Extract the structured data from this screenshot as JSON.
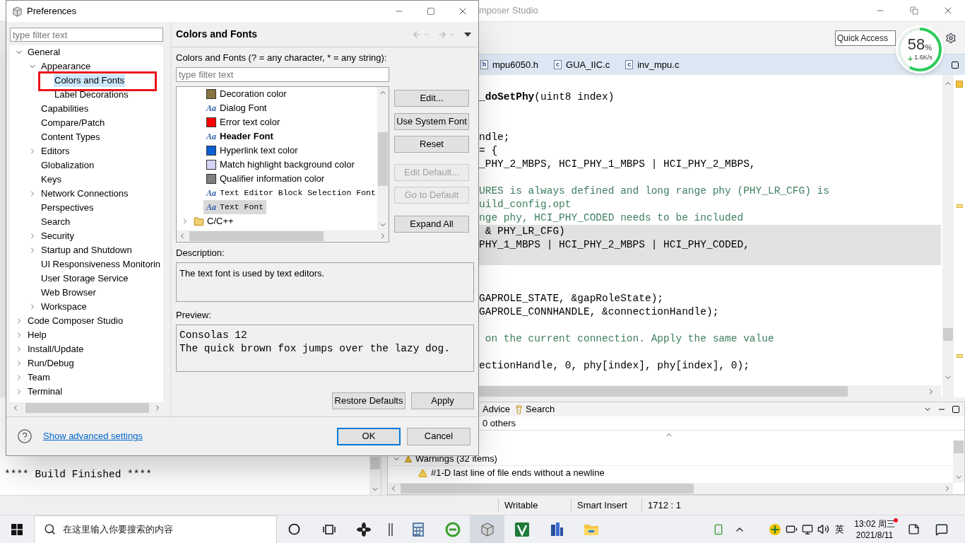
{
  "ide": {
    "title": "mposer Studio",
    "quick_access": "Quick Access",
    "net_meter": {
      "percent": "58",
      "unit": "%",
      "speed": "1.6K/s",
      "level": 0.58
    },
    "editor_tabs": [
      {
        "badge": "h",
        "label": "mpu6050.h",
        "selected": false
      },
      {
        "badge": "c",
        "label": "GUA_IIC.c",
        "selected": false
      },
      {
        "badge": "c",
        "label": "inv_mpu.c",
        "selected": false
      }
    ],
    "code_lines": [
      {
        "kind": "code",
        "text": "**_doSetPhy**(uint8 index)",
        "highlighted": false
      },
      {
        "kind": "blank",
        "highlighted": false
      },
      {
        "kind": "blank",
        "highlighted": false
      },
      {
        "kind": "code",
        "text": "ndle;",
        "highlighted": false
      },
      {
        "kind": "code",
        "text": "= {",
        "highlighted": false
      },
      {
        "kind": "code",
        "text": "_PHY_2_MBPS, HCI_PHY_1_MBPS | HCI_PHY_2_MBPS,",
        "highlighted": false
      },
      {
        "kind": "blank",
        "highlighted": false
      },
      {
        "kind": "comment",
        "text": "URES is always defined and long range phy (PHY_LR_CFG) is",
        "highlighted": false
      },
      {
        "kind": "comment",
        "text": "uild_config.opt",
        "highlighted": false
      },
      {
        "kind": "comment",
        "text": "nge phy, HCI_PHY_CODED needs to be included",
        "highlighted": false
      },
      {
        "kind": "code",
        "text": " & PHY_LR_CFG)",
        "highlighted": true
      },
      {
        "kind": "code",
        "text": "PHY_1_MBPS | HCI_PHY_2_MBPS | HCI_PHY_CODED,",
        "highlighted": true
      },
      {
        "kind": "blank",
        "highlighted": true
      },
      {
        "kind": "blank",
        "highlighted": false
      },
      {
        "kind": "blank",
        "highlighted": false
      },
      {
        "kind": "code",
        "text": "GAPROLE_STATE, &gapRoleState);",
        "highlighted": false
      },
      {
        "kind": "code",
        "text": "GAPROLE_CONNHANDLE, &connectionHandle);",
        "highlighted": false
      },
      {
        "kind": "blank",
        "highlighted": false
      },
      {
        "kind": "comment",
        "text": " on the current connection. Apply the same value",
        "highlighted": false
      },
      {
        "kind": "blank",
        "highlighted": false
      },
      {
        "kind": "code",
        "text": "ectionHandle, 0, phy[index], phy[index], 0);",
        "highlighted": false
      },
      {
        "kind": "blank",
        "highlighted": false
      }
    ],
    "problems": {
      "tabs": [
        {
          "label": "Advice",
          "selected": false
        },
        {
          "label": "Search",
          "selected": false
        }
      ],
      "summary": "0 others",
      "groups": [
        {
          "label": "Warnings (32 items)",
          "expanded": true,
          "items": [
            "#1-D last line of file ends without a newline"
          ]
        }
      ]
    },
    "console": {
      "lines": [
        "**** Build Finished ****"
      ]
    },
    "status_bar": [
      "Writable",
      "Smart Insert",
      "1712 : 1"
    ]
  },
  "dialog": {
    "title": "Preferences",
    "filter_placeholder": "type filter text",
    "tree": [
      {
        "label": "General",
        "expanded": true,
        "selected": false,
        "children": [
          {
            "label": "Appearance",
            "expanded": true,
            "selected": false,
            "children": [
              {
                "label": "Colors and Fonts",
                "selected": true,
                "framed": true
              },
              {
                "label": "Label Decorations",
                "selected": false
              }
            ]
          },
          {
            "label": "Capabilities",
            "selected": false
          },
          {
            "label": "Compare/Patch",
            "selected": false
          },
          {
            "label": "Content Types",
            "selected": false
          },
          {
            "label": "Editors",
            "expanded": false,
            "selected": false
          },
          {
            "label": "Globalization",
            "selected": false
          },
          {
            "label": "Keys",
            "selected": false
          },
          {
            "label": "Network Connections",
            "expanded": false,
            "selected": false
          },
          {
            "label": "Perspectives",
            "selected": false
          },
          {
            "label": "Search",
            "selected": false
          },
          {
            "label": "Security",
            "expanded": false,
            "selected": false
          },
          {
            "label": "Startup and Shutdown",
            "expanded": false,
            "selected": false
          },
          {
            "label": "UI Responsiveness Monitorin",
            "selected": false
          },
          {
            "label": "User Storage Service",
            "selected": false
          },
          {
            "label": "Web Browser",
            "selected": false
          },
          {
            "label": "Workspace",
            "expanded": false,
            "selected": false
          }
        ]
      },
      {
        "label": "Code Composer Studio",
        "expanded": false,
        "selected": false
      },
      {
        "label": "Help",
        "expanded": false,
        "selected": false
      },
      {
        "label": "Install/Update",
        "expanded": false,
        "selected": false
      },
      {
        "label": "Run/Debug",
        "expanded": false,
        "selected": false
      },
      {
        "label": "Team",
        "expanded": false,
        "selected": false
      },
      {
        "label": "Terminal",
        "expanded": false,
        "selected": false
      }
    ],
    "page_title": "Colors and Fonts",
    "filter_label": "Colors and Fonts (? = any character, * = any string):",
    "list_filter_placeholder": "type filter text",
    "items": [
      {
        "kind": "color",
        "label": "Decoration color",
        "color": "#8b7340",
        "selected": false
      },
      {
        "kind": "font",
        "icon": "Aa",
        "label": "Dialog Font",
        "selected": false
      },
      {
        "kind": "color",
        "label": "Error text color",
        "color": "#ff0000",
        "selected": false
      },
      {
        "kind": "bold-font",
        "icon": "Aa",
        "label": "Header Font",
        "selected": false
      },
      {
        "kind": "color",
        "label": "Hyperlink text color",
        "color": "#0a5fd3",
        "selected": false
      },
      {
        "kind": "color",
        "label": "Match highlight background color",
        "color": "#d4d4f8",
        "selected": false
      },
      {
        "kind": "color",
        "label": "Qualifier information color",
        "color": "#808080",
        "selected": false
      },
      {
        "kind": "mono-font",
        "icon": "Aa",
        "label": "Text Editor Block Selection Font",
        "selected": false
      },
      {
        "kind": "mono-font",
        "icon": "Aa",
        "label": "Text Font",
        "selected": true
      },
      {
        "kind": "category",
        "label": "C/C++",
        "expanded": false,
        "selected": false
      }
    ],
    "side_buttons": [
      {
        "label": "Edit...",
        "disabled": false
      },
      {
        "label": "Use System Font",
        "disabled": false
      },
      {
        "label": "Reset",
        "disabled": false
      },
      {
        "label": "Edit Default...",
        "disabled": true
      },
      {
        "label": "Go to Default",
        "disabled": true
      },
      {
        "label": "Expand All",
        "disabled": false
      }
    ],
    "description_label": "Description:",
    "description": "The text font is used by text editors.",
    "preview_label": "Preview:",
    "preview_lines": [
      "Consolas 12",
      "The quick brown fox jumps over the lazy dog."
    ],
    "page_buttons": [
      "Restore Defaults",
      "Apply"
    ],
    "advanced_link": "Show advanced settings",
    "dialog_buttons": [
      {
        "label": "OK",
        "default": true
      },
      {
        "label": "Cancel",
        "default": false
      }
    ]
  },
  "taskbar": {
    "search_placeholder": "在这里输入你要搜索的内容",
    "apps": [
      {
        "kind": "cortana",
        "selected": false
      },
      {
        "kind": "taskview",
        "selected": false
      },
      {
        "kind": "pinwheel",
        "selected": false
      },
      {
        "kind": "bars",
        "selected": false
      },
      {
        "kind": "calculator",
        "selected": false
      },
      {
        "kind": "browser",
        "selected": false
      },
      {
        "kind": "cube",
        "selected": true
      },
      {
        "kind": "vim",
        "selected": false
      },
      {
        "kind": "building",
        "selected": false
      },
      {
        "kind": "folder",
        "selected": false
      }
    ],
    "ime": "英",
    "time": "13:02 周三",
    "date": "2021/8/11",
    "notification_dot": true
  }
}
